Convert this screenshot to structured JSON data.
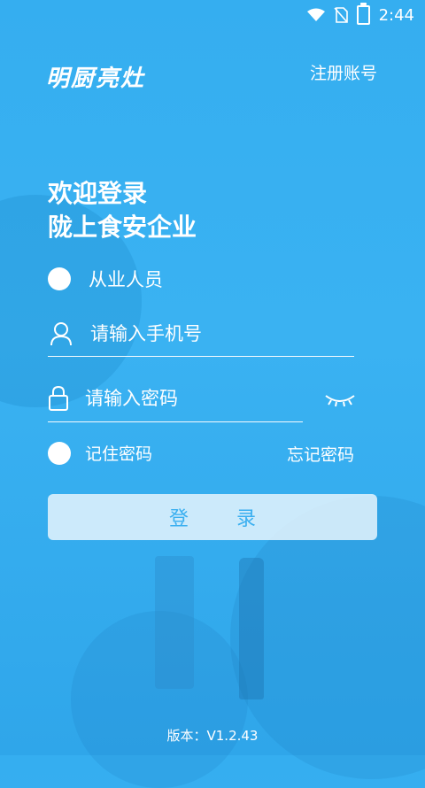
{
  "status_bar": {
    "time": "2:44",
    "icons": [
      "wifi-icon",
      "no-sim-icon",
      "battery-charging-icon"
    ]
  },
  "header": {
    "logo_text": "明厨亮灶",
    "register_label": "注册账号"
  },
  "welcome": {
    "line1": "欢迎登录",
    "line2": "陇上食安企业"
  },
  "role": {
    "label": "从业人员",
    "selected": false
  },
  "form": {
    "phone_placeholder": "请输入手机号",
    "phone_value": "",
    "password_placeholder": "请输入密码",
    "password_value": "",
    "remember_label": "记住密码",
    "remember_checked": false,
    "forgot_label": "忘记密码",
    "login_label": "登录"
  },
  "footer": {
    "version": "版本：V1.2.43"
  },
  "colors": {
    "background": "#35aef0",
    "button_bg": "#e6f5fd",
    "button_text": "#3aaff0"
  }
}
